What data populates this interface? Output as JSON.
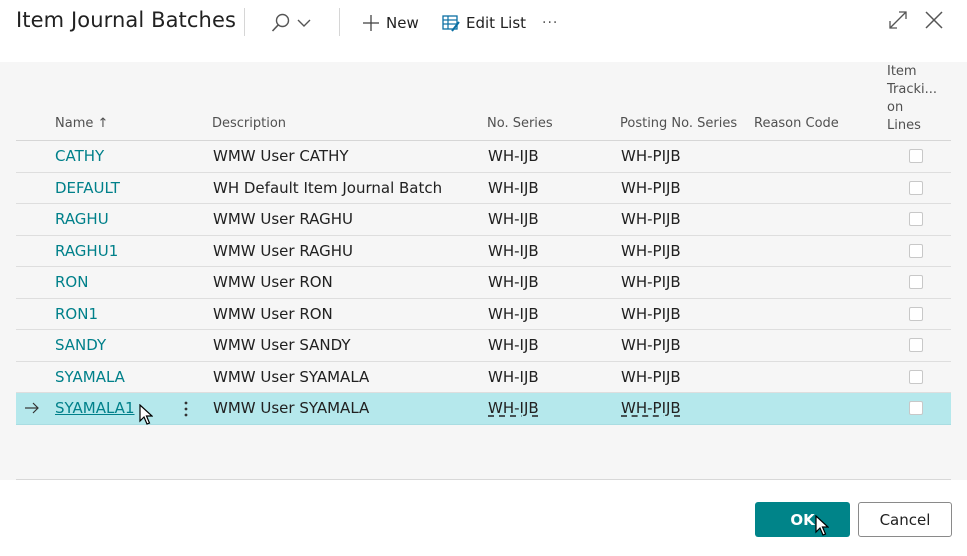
{
  "header": {
    "title": "Item Journal Batches",
    "toolbar": {
      "search_icon": "search-icon",
      "new_label": "New",
      "edit_list_label": "Edit List",
      "more_label": "···"
    },
    "window_icons": [
      "expand-icon",
      "close-icon"
    ]
  },
  "table": {
    "columns": {
      "name": "Name",
      "sort_indicator": "↑",
      "description": "Description",
      "no_series": "No. Series",
      "posting_no_series": "Posting No. Series",
      "reason_code": "Reason Code",
      "item_tracking_line1": "Item",
      "item_tracking_line2": "Tracki...",
      "item_tracking_line3": "on",
      "item_tracking_line4": "Lines"
    },
    "rows": [
      {
        "name": "CATHY",
        "description": "WMW User CATHY",
        "no_series": "WH-IJB",
        "posting_no_series": "WH-PIJB",
        "reason_code": "",
        "item_tracking": false
      },
      {
        "name": "DEFAULT",
        "description": "WH Default Item Journal Batch",
        "no_series": "WH-IJB",
        "posting_no_series": "WH-PIJB",
        "reason_code": "",
        "item_tracking": false
      },
      {
        "name": "RAGHU",
        "description": "WMW User RAGHU",
        "no_series": "WH-IJB",
        "posting_no_series": "WH-PIJB",
        "reason_code": "",
        "item_tracking": false
      },
      {
        "name": "RAGHU1",
        "description": "WMW User RAGHU",
        "no_series": "WH-IJB",
        "posting_no_series": "WH-PIJB",
        "reason_code": "",
        "item_tracking": false
      },
      {
        "name": "RON",
        "description": "WMW User RON",
        "no_series": "WH-IJB",
        "posting_no_series": "WH-PIJB",
        "reason_code": "",
        "item_tracking": false
      },
      {
        "name": "RON1",
        "description": "WMW User RON",
        "no_series": "WH-IJB",
        "posting_no_series": "WH-PIJB",
        "reason_code": "",
        "item_tracking": false
      },
      {
        "name": "SANDY",
        "description": "WMW User SANDY",
        "no_series": "WH-IJB",
        "posting_no_series": "WH-PIJB",
        "reason_code": "",
        "item_tracking": false
      },
      {
        "name": "SYAMALA",
        "description": "WMW User SYAMALA",
        "no_series": "WH-IJB",
        "posting_no_series": "WH-PIJB",
        "reason_code": "",
        "item_tracking": false
      },
      {
        "name": "SYAMALA1",
        "description": "WMW User SYAMALA",
        "no_series": "WH-IJB",
        "posting_no_series": "WH-PIJB",
        "reason_code": "",
        "item_tracking": false,
        "selected": true
      }
    ]
  },
  "footer": {
    "ok_label": "OK",
    "cancel_label": "Cancel"
  },
  "colors": {
    "accent": "#008489",
    "link": "#00808a",
    "selected_row": "#b5e8ec",
    "grid_background": "#f6f6f6"
  }
}
